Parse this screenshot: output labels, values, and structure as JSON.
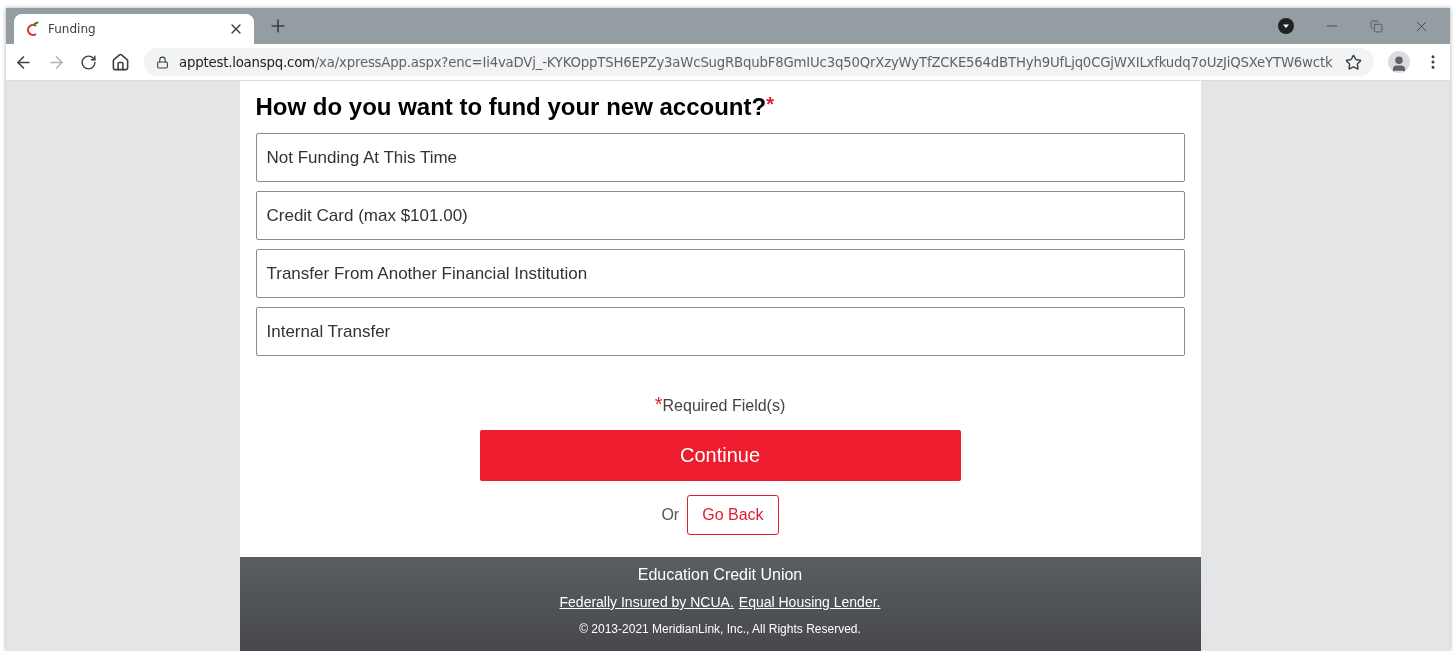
{
  "browser": {
    "tab_title": "Funding",
    "url_host": "apptest.loanspq.com",
    "url_path": "/xa/xpressApp.aspx?enc=Ii4vaDVj_-KYKOppTSH6EPZy3aWcSugRBqubF8GmIUc3q50QrXzyWyTfZCKE564dBTHyh9UfLjq0CGjWXILxfkudq7oUzJiQSXeYTW6wctk"
  },
  "heading": "How do you want to fund your new account?",
  "required_mark": "*",
  "options": [
    {
      "label": "Not Funding At This Time"
    },
    {
      "label": "Credit Card (max $101.00)"
    },
    {
      "label": "Transfer From Another Financial Institution"
    },
    {
      "label": "Internal Transfer"
    }
  ],
  "required_note": {
    "mark": "*",
    "text": "Required Field(s)"
  },
  "continue_button": "Continue",
  "or_text": "Or",
  "back_button": "Go Back",
  "footer": {
    "title": "Education Credit Union",
    "links": [
      "Federally Insured by NCUA.",
      "Equal Housing Lender."
    ],
    "copyright": "© 2013-2021 MeridianLink, Inc., All Rights Reserved."
  }
}
